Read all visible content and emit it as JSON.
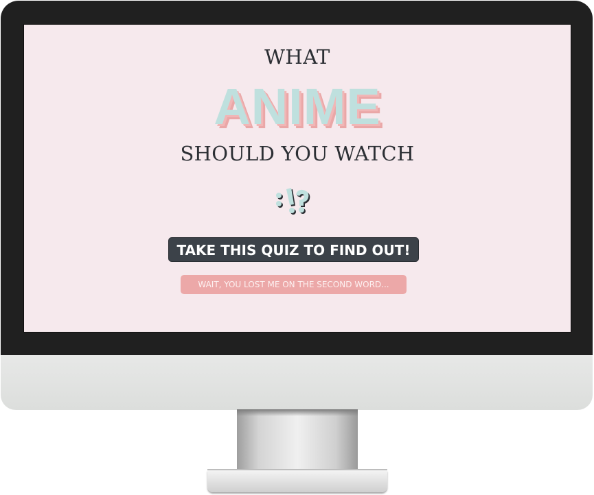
{
  "hero": {
    "title_line1": "WHAT",
    "title_highlight": "ANIME",
    "title_line3": "SHOULD YOU WATCH",
    "icon": "interrobang-icon"
  },
  "actions": {
    "primary_label": "TAKE THIS QUIZ TO FIND OUT!",
    "secondary_label": "WAIT, YOU LOST ME ON THE SECOND WORD..."
  },
  "colors": {
    "screen_bg": "#f6e9ed",
    "text_dark": "#2c2f34",
    "mint": "#bfe0de",
    "pink": "#eca8a8",
    "button_dark": "#3c4249"
  }
}
